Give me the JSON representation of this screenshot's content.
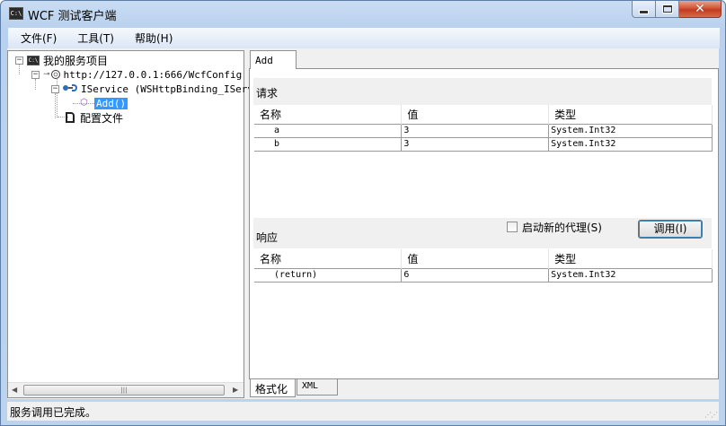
{
  "window": {
    "title": "WCF 测试客户端",
    "icon_text": "C:\\"
  },
  "menu": {
    "items": [
      "文件(F)",
      "工具(T)",
      "帮助(H)"
    ]
  },
  "tree": {
    "root_label": "我的服务项目",
    "endpoint": "http://127.0.0.1:666/WcfConfig",
    "contract": "IService (WSHttpBinding_IServi",
    "operation": "Add()",
    "config_file": "配置文件"
  },
  "tab": {
    "name": "Add"
  },
  "request": {
    "title": "请求",
    "columns": [
      "名称",
      "值",
      "类型"
    ],
    "rows": [
      [
        "a",
        "3",
        "System.Int32"
      ],
      [
        "b",
        "3",
        "System.Int32"
      ]
    ]
  },
  "response": {
    "title": "响应",
    "new_proxy_label": "启动新的代理(S)",
    "new_proxy_checked": false,
    "invoke_label": "调用(I)",
    "columns": [
      "名称",
      "值",
      "类型"
    ],
    "rows": [
      [
        "(return)",
        "6",
        "System.Int32"
      ]
    ]
  },
  "bottom_tabs": [
    "格式化",
    "XML"
  ],
  "status": {
    "text": "服务调用已完成。"
  }
}
